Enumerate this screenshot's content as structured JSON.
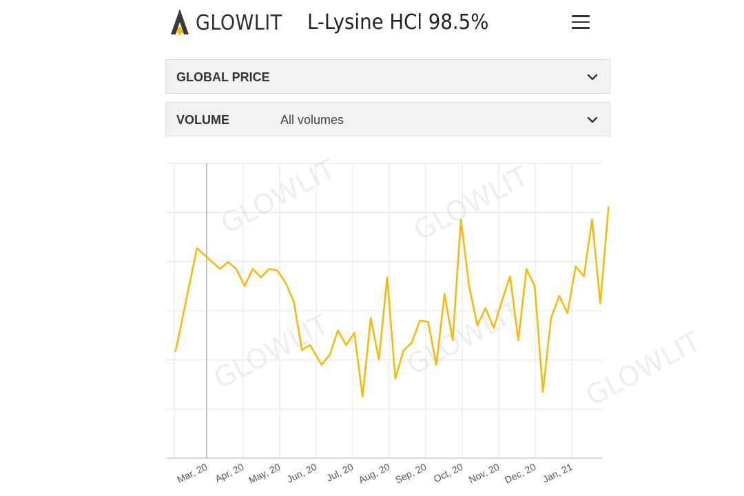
{
  "header": {
    "brand": "GLOWLIT",
    "product_title": "L-Lysine HCl 98.5%",
    "logo_icon": "glowlit-flame-logo",
    "menu_icon": "hamburger-menu-icon"
  },
  "filters": {
    "price": {
      "label": "GLOBAL PRICE",
      "value": ""
    },
    "volume": {
      "label": "VOLUME",
      "value": "All volumes"
    }
  },
  "watermark": "GLOWLIT",
  "colors": {
    "line": "#f6b90c",
    "grid": "#e6e6e6",
    "axis": "#bfbfbf",
    "cursor": "#9a9a9a"
  },
  "chart_data": {
    "type": "line",
    "title": "",
    "xlabel": "",
    "ylabel": "",
    "x_tick_labels": [
      "Mar, 20",
      "Apr, 20",
      "May, 20",
      "Jun, 20",
      "Jul, 20",
      "Aug, 20",
      "Sep, 20",
      "Oct, 20",
      "Nov, 20",
      "Dec, 20",
      "Jan, 21"
    ],
    "ylim": [
      0,
      6
    ],
    "grid": true,
    "y_ticks_visible": false,
    "series": [
      {
        "name": "",
        "values": [
          {
            "x": 0.0,
            "y": 2.18
          },
          {
            "x": 0.65,
            "y": 4.27
          },
          {
            "x": 1.0,
            "y": 4.06
          },
          {
            "x": 1.35,
            "y": 3.85
          },
          {
            "x": 1.6,
            "y": 3.99
          },
          {
            "x": 1.85,
            "y": 3.85
          },
          {
            "x": 2.1,
            "y": 3.5
          },
          {
            "x": 2.35,
            "y": 3.85
          },
          {
            "x": 2.6,
            "y": 3.68
          },
          {
            "x": 2.85,
            "y": 3.85
          },
          {
            "x": 3.1,
            "y": 3.82
          },
          {
            "x": 3.35,
            "y": 3.57
          },
          {
            "x": 3.6,
            "y": 3.19
          },
          {
            "x": 3.85,
            "y": 2.2
          },
          {
            "x": 4.1,
            "y": 2.3
          },
          {
            "x": 4.45,
            "y": 1.9
          },
          {
            "x": 4.7,
            "y": 2.1
          },
          {
            "x": 4.95,
            "y": 2.6
          },
          {
            "x": 5.2,
            "y": 2.3
          },
          {
            "x": 5.45,
            "y": 2.55
          },
          {
            "x": 5.7,
            "y": 1.25
          },
          {
            "x": 5.95,
            "y": 2.85
          },
          {
            "x": 6.2,
            "y": 2.0
          },
          {
            "x": 6.45,
            "y": 3.68
          },
          {
            "x": 6.7,
            "y": 1.62
          },
          {
            "x": 6.95,
            "y": 2.19
          },
          {
            "x": 7.2,
            "y": 2.35
          },
          {
            "x": 7.45,
            "y": 2.8
          },
          {
            "x": 7.7,
            "y": 2.77
          },
          {
            "x": 7.95,
            "y": 1.9
          },
          {
            "x": 8.2,
            "y": 3.34
          },
          {
            "x": 8.45,
            "y": 2.4
          },
          {
            "x": 8.7,
            "y": 4.85
          },
          {
            "x": 8.95,
            "y": 3.5
          },
          {
            "x": 9.2,
            "y": 2.7
          },
          {
            "x": 9.45,
            "y": 3.05
          },
          {
            "x": 9.7,
            "y": 2.65
          },
          {
            "x": 9.95,
            "y": 3.2
          },
          {
            "x": 10.2,
            "y": 3.7
          },
          {
            "x": 10.45,
            "y": 2.4
          },
          {
            "x": 10.7,
            "y": 3.85
          },
          {
            "x": 10.95,
            "y": 3.5
          },
          {
            "x": 11.2,
            "y": 1.35
          },
          {
            "x": 11.45,
            "y": 2.85
          },
          {
            "x": 11.7,
            "y": 3.3
          },
          {
            "x": 11.95,
            "y": 2.95
          },
          {
            "x": 12.2,
            "y": 3.9
          },
          {
            "x": 12.45,
            "y": 3.7
          },
          {
            "x": 12.7,
            "y": 4.85
          },
          {
            "x": 12.95,
            "y": 3.15
          },
          {
            "x": 13.2,
            "y": 5.1
          }
        ]
      }
    ]
  }
}
